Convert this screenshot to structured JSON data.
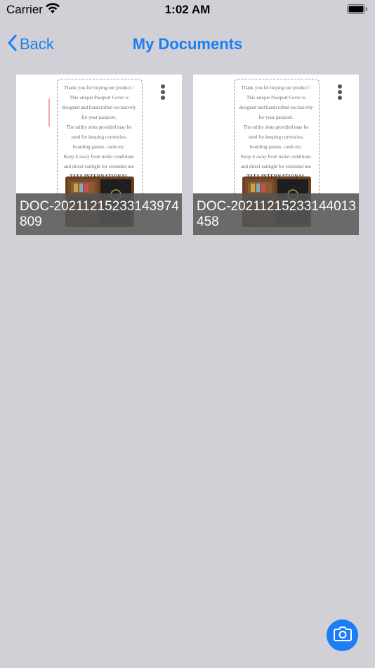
{
  "status_bar": {
    "carrier": "Carrier",
    "time": "1:02 AM",
    "wifi_icon": "wifi-icon",
    "battery_icon": "battery-icon"
  },
  "nav": {
    "back_label": "Back",
    "title": "My Documents",
    "back_icon": "chevron-left-icon"
  },
  "colors": {
    "accent": "#1b7ef5",
    "background": "#d1d0d6",
    "caption_overlay": "#555555"
  },
  "thumbnail_text": {
    "lines": [
      "Thank you for buying our product !",
      "This unique Passport Cover is",
      "designed and handcrafted exclusively",
      "for your passport.",
      "The utility slots provided may be",
      "used for keeping currencies,",
      "boarding passes, cards etc.",
      "Keep it away from moist conditions",
      "and direct sunlight for extended use"
    ],
    "brand": "TATA INTERNATIONAL"
  },
  "documents": [
    {
      "name": "DOC-20211215233143974809",
      "menu_icon": "more-vertical-icon"
    },
    {
      "name": "DOC-20211215233144013458",
      "menu_icon": "more-vertical-icon"
    }
  ],
  "fab": {
    "icon": "camera-icon"
  }
}
